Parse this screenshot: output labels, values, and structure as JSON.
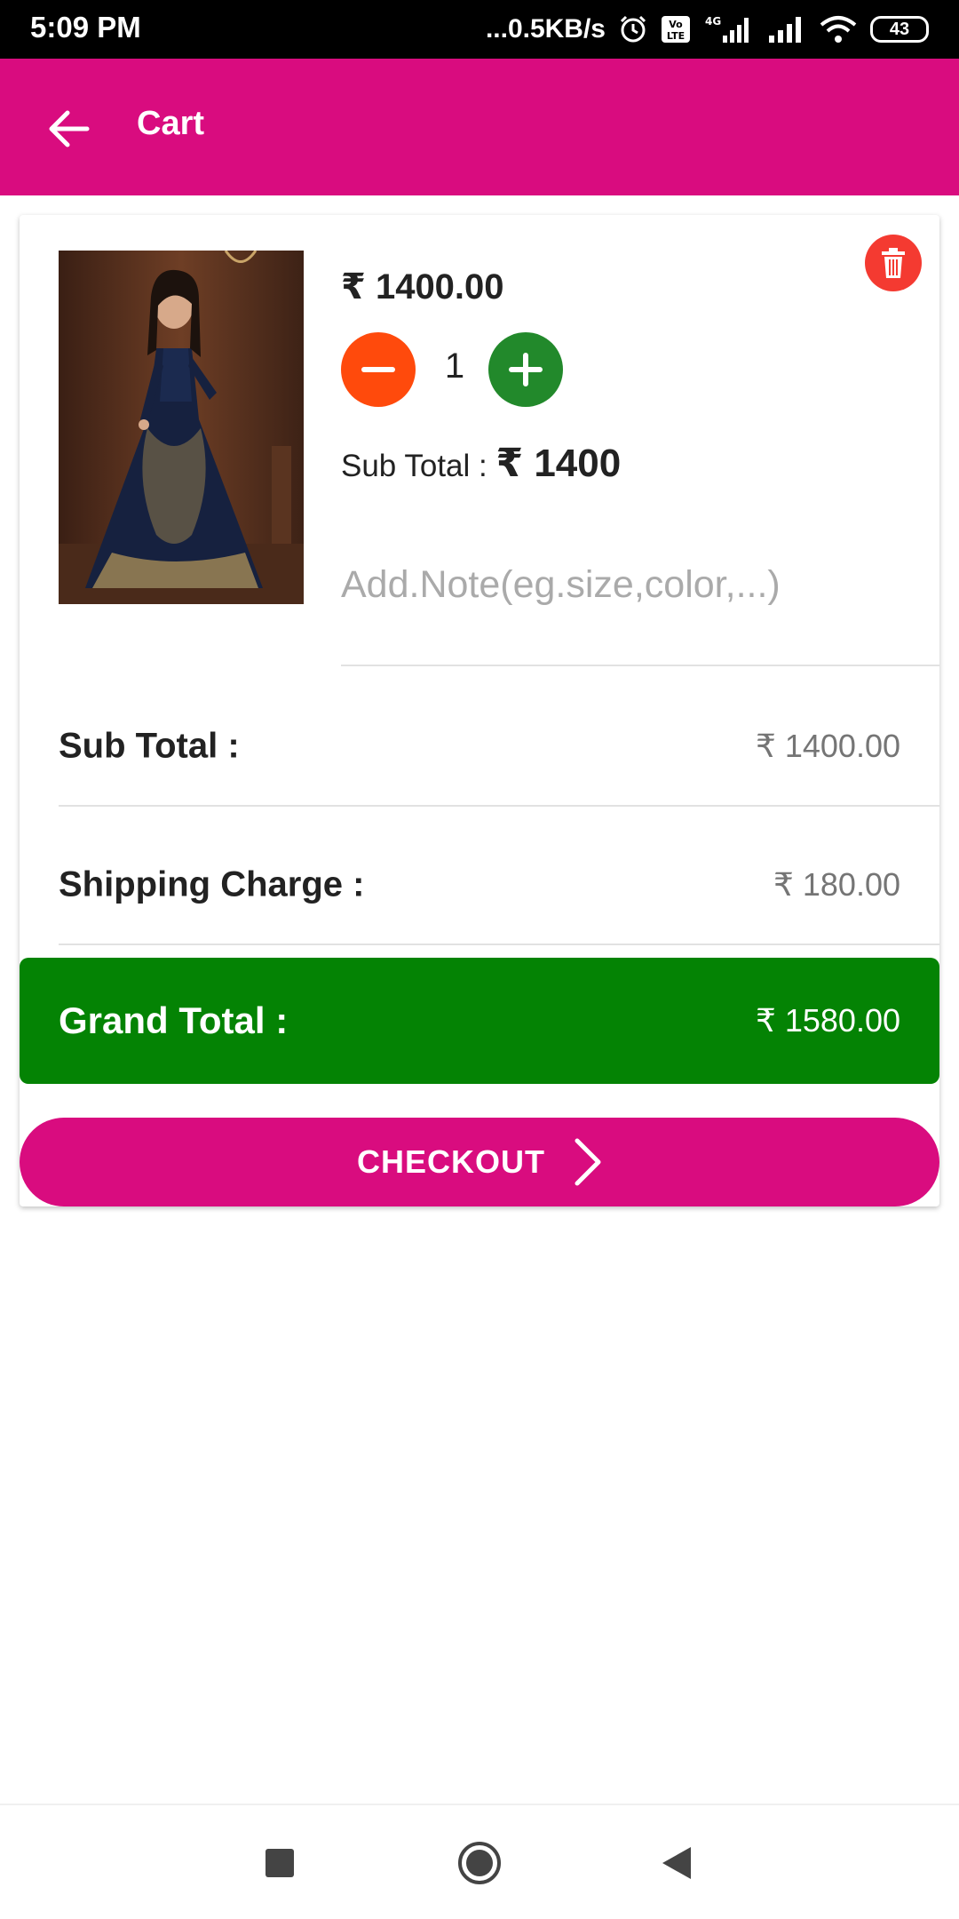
{
  "status_bar": {
    "time": "5:09 PM",
    "network_speed": "...0.5KB/s",
    "battery": "43",
    "icons": [
      "alarm-icon",
      "volte-icon",
      "signal-4g-icon",
      "signal-icon",
      "wifi-icon",
      "battery-icon"
    ]
  },
  "app_bar": {
    "title": "Cart",
    "back_icon": "arrow-left-icon",
    "color": "#d90c7f"
  },
  "cart_item": {
    "price": "₹ 1400.00",
    "quantity": "1",
    "subtotal_label": "Sub Total : ",
    "subtotal_value": "₹ 1400",
    "note_placeholder": "Add.Note(eg.size,color,...)",
    "delete_icon": "trash-icon",
    "minus_icon": "minus-icon",
    "plus_icon": "plus-icon",
    "image_description": "product-photo"
  },
  "summary": {
    "subtotal_label": "Sub Total :",
    "subtotal_value": "₹ 1400.00",
    "shipping_label": "Shipping Charge :",
    "shipping_value": "₹ 180.00",
    "grand_label": "Grand Total :",
    "grand_value": "₹ 1580.00",
    "grand_color": "#048304"
  },
  "checkout": {
    "label": "CHECKOUT",
    "icon": "chevron-right-icon"
  },
  "nav_bar": {
    "icons": [
      "recents-square-icon",
      "home-circle-icon",
      "back-triangle-icon"
    ]
  }
}
